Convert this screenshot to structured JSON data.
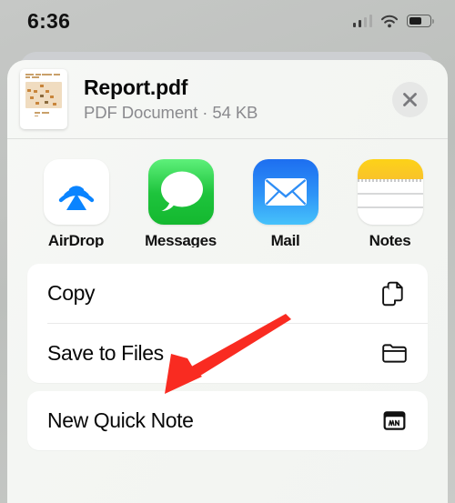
{
  "status_bar": {
    "time": "6:36",
    "cellular_icon": "cellular-signal-icon",
    "wifi_icon": "wifi-icon",
    "battery_icon": "battery-icon",
    "battery_level_percent": 62,
    "cellular_bars_filled": 2,
    "cellular_bars_total": 4
  },
  "share_sheet": {
    "file": {
      "name": "Report.pdf",
      "subtitle": "PDF Document · 54 KB",
      "kind": "PDF Document",
      "size": "54 KB",
      "thumbnail_icon": "pdf-page-thumbnail"
    },
    "close_button": {
      "icon": "close-x-icon",
      "label": "Close"
    },
    "apps": [
      {
        "label": "AirDrop",
        "icon": "airdrop-icon"
      },
      {
        "label": "Messages",
        "icon": "messages-icon"
      },
      {
        "label": "Mail",
        "icon": "mail-icon"
      },
      {
        "label": "Notes",
        "icon": "notes-icon"
      },
      {
        "label": "",
        "icon": "google-drive-icon"
      }
    ],
    "actions_primary": [
      {
        "label": "Copy",
        "icon": "copy-documents-icon"
      },
      {
        "label": "Save to Files",
        "icon": "folder-icon"
      }
    ],
    "actions_secondary": [
      {
        "label": "New Quick Note",
        "icon": "quick-note-icon"
      }
    ]
  },
  "annotation": {
    "arrow_color": "#f92b21",
    "points_at": "Save to Files"
  },
  "colors": {
    "backdrop": "#c3c6c3",
    "sheet_bg": "#f4f6f3",
    "card_bg": "#ffffff",
    "primary_text": "#080808",
    "secondary_text": "#8a8a8e",
    "messages_green": "#1ec43d",
    "mail_blue": "#2f95f7",
    "notes_yellow": "#fbc92a",
    "airdrop_blue": "#0a84ff"
  }
}
